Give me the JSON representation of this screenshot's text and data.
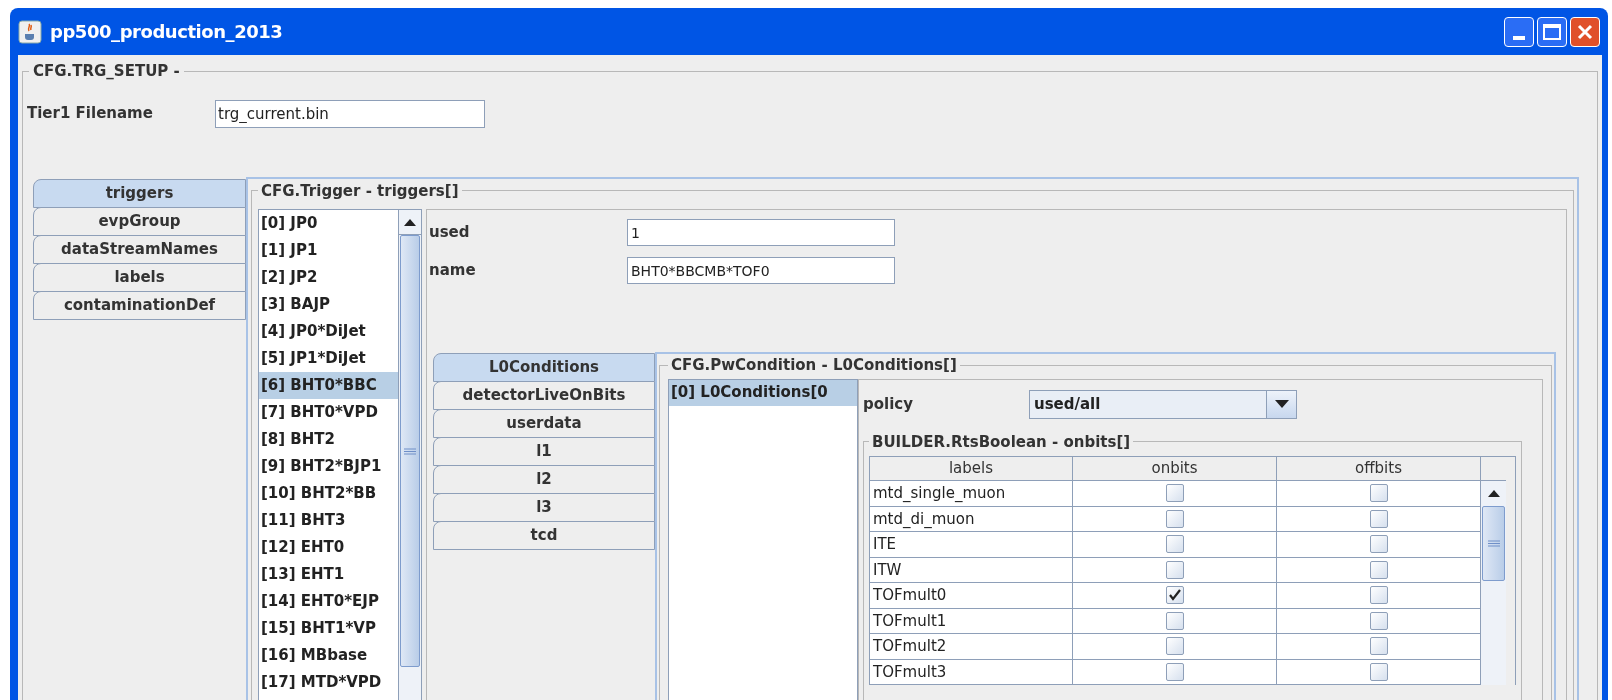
{
  "window": {
    "title": "pp500_production_2013"
  },
  "setup": {
    "legend": "CFG.TRG_SETUP -",
    "filename_label": "Tier1 Filename",
    "filename_value": "trg_current.bin"
  },
  "tabs": [
    {
      "label": "triggers",
      "selected": true
    },
    {
      "label": "evpGroup",
      "selected": false
    },
    {
      "label": "dataStreamNames",
      "selected": false
    },
    {
      "label": "labels",
      "selected": false
    },
    {
      "label": "contaminationDef",
      "selected": false
    }
  ],
  "trigger_panel": {
    "legend": "CFG.Trigger - triggers[]",
    "list": [
      {
        "label": "[0] JP0",
        "selected": false
      },
      {
        "label": "[1] JP1",
        "selected": false
      },
      {
        "label": "[2] JP2",
        "selected": false
      },
      {
        "label": "[3] BAJP",
        "selected": false
      },
      {
        "label": "[4] JP0*DiJet",
        "selected": false
      },
      {
        "label": "[5] JP1*DiJet",
        "selected": false
      },
      {
        "label": "[6] BHT0*BBC",
        "selected": true
      },
      {
        "label": "[7] BHT0*VPD",
        "selected": false
      },
      {
        "label": "[8] BHT2",
        "selected": false
      },
      {
        "label": "[9] BHT2*BJP1",
        "selected": false
      },
      {
        "label": "[10] BHT2*BB",
        "selected": false
      },
      {
        "label": "[11] BHT3",
        "selected": false
      },
      {
        "label": "[12] EHT0",
        "selected": false
      },
      {
        "label": "[13] EHT1",
        "selected": false
      },
      {
        "label": "[14] EHT0*EJP",
        "selected": false
      },
      {
        "label": "[15] BHT1*VP",
        "selected": false
      },
      {
        "label": "[16] MBbase",
        "selected": false
      },
      {
        "label": "[17] MTD*VPD",
        "selected": false
      }
    ],
    "fields": [
      {
        "label": "used",
        "value": "1"
      },
      {
        "label": "name",
        "value": "BHT0*BBCMB*TOF0"
      }
    ],
    "sub_tabs": [
      {
        "label": "L0Conditions",
        "selected": true
      },
      {
        "label": "detectorLiveOnBits",
        "selected": false
      },
      {
        "label": "userdata",
        "selected": false
      },
      {
        "label": "l1",
        "selected": false
      },
      {
        "label": "l2",
        "selected": false
      },
      {
        "label": "l3",
        "selected": false
      },
      {
        "label": "tcd",
        "selected": false
      }
    ],
    "condition_panel": {
      "legend": "CFG.PwCondition - L0Conditions[]",
      "list": [
        {
          "label": "[0] L0Conditions[0",
          "selected": true
        }
      ],
      "policy": {
        "label": "policy",
        "value": "used/all"
      },
      "table": {
        "legend": "BUILDER.RtsBoolean - onbits[]",
        "columns": [
          "labels",
          "onbits",
          "offbits"
        ],
        "rows": [
          {
            "label": "mtd_single_muon",
            "onbits": false,
            "offbits": false
          },
          {
            "label": "mtd_di_muon",
            "onbits": false,
            "offbits": false
          },
          {
            "label": "ITE",
            "onbits": false,
            "offbits": false
          },
          {
            "label": "ITW",
            "onbits": false,
            "offbits": false
          },
          {
            "label": "TOFmult0",
            "onbits": true,
            "offbits": false
          },
          {
            "label": "TOFmult1",
            "onbits": false,
            "offbits": false
          },
          {
            "label": "TOFmult2",
            "onbits": false,
            "offbits": false
          },
          {
            "label": "TOFmult3",
            "onbits": false,
            "offbits": false
          }
        ]
      }
    }
  }
}
